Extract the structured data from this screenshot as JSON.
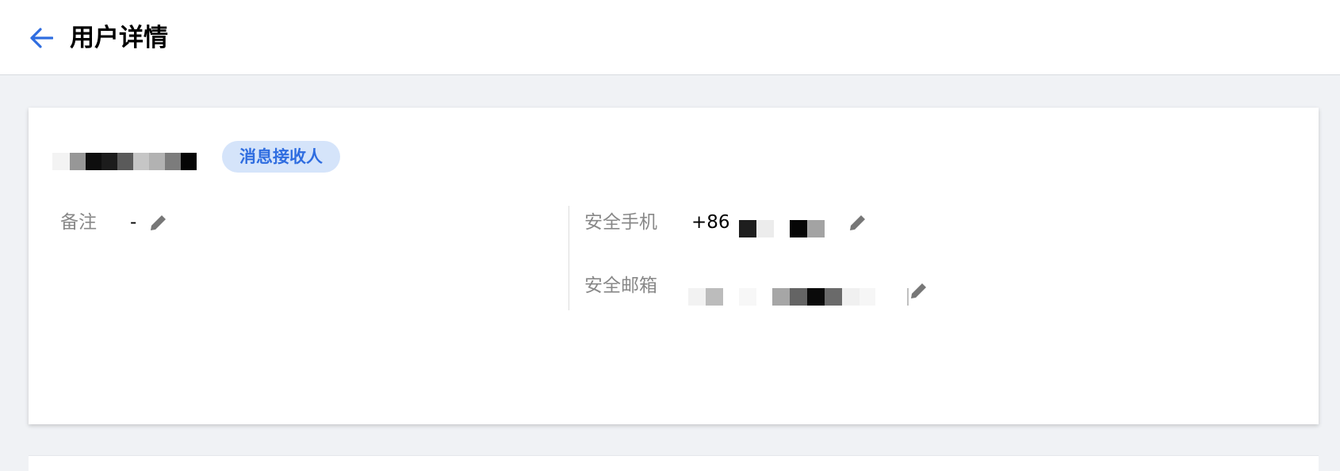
{
  "header": {
    "title": "用户详情",
    "back_icon": "arrow-left-icon",
    "back_color": "#2f6de0"
  },
  "profile": {
    "name_masked": "",
    "tag_label": "消息接收人",
    "tag_color": "#2f6de0",
    "tag_bg": "#d5e4fa"
  },
  "fields": {
    "remark": {
      "label": "备注",
      "value": "-",
      "edit_icon": "pencil-icon"
    },
    "phone": {
      "label": "安全手机",
      "prefix": "+86",
      "edit_icon": "pencil-icon"
    },
    "email": {
      "label": "安全邮箱",
      "edit_icon": "pencil-icon"
    }
  },
  "colors": {
    "page_bg": "#f0f2f5",
    "label": "#888888",
    "icon_gray": "#777777"
  }
}
